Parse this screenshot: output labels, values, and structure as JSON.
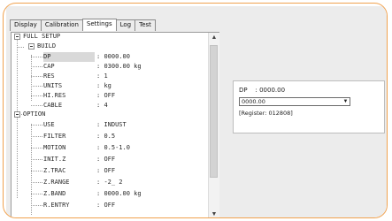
{
  "tabs": [
    "Display",
    "Calibration",
    "Settings",
    "Log",
    "Test"
  ],
  "active_tab": "Settings",
  "tree": {
    "root": "FULL SETUP",
    "groups": [
      {
        "name": "BUILD",
        "items": [
          {
            "key": "DP",
            "value": "0000.00",
            "selected": true
          },
          {
            "key": "CAP",
            "value": "0300.00 kg"
          },
          {
            "key": "RES",
            "value": "1"
          },
          {
            "key": "UNITS",
            "value": "kg"
          },
          {
            "key": "HI.RES",
            "value": "OFF"
          },
          {
            "key": "CABLE",
            "value": "4"
          }
        ]
      },
      {
        "name": "OPTION",
        "items": [
          {
            "key": "USE",
            "value": "INDUST"
          },
          {
            "key": "FILTER",
            "value": "0.5"
          },
          {
            "key": "MOTION",
            "value": "0.5-1.0"
          },
          {
            "key": "INIT.Z",
            "value": "OFF"
          },
          {
            "key": "Z.TRAC",
            "value": "OFF"
          },
          {
            "key": "Z.RANGE",
            "value": "-2_ 2"
          },
          {
            "key": "Z.BAND",
            "value": "0000.00 kg"
          },
          {
            "key": "R.ENTRY",
            "value": "OFF"
          }
        ]
      }
    ]
  },
  "property": {
    "title": "DP    : 0000.00",
    "selected_value": "0000.00",
    "register": "[Register: 012808]"
  },
  "scrollbar": {
    "up_glyph": "▲",
    "down_glyph": "▼"
  },
  "dropdown": {
    "arrow_glyph": "▼"
  }
}
